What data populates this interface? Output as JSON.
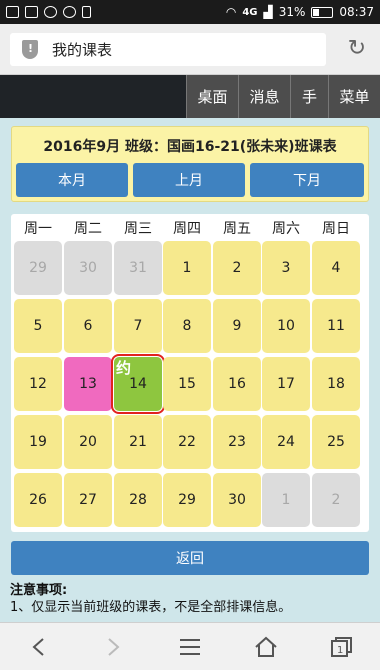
{
  "status_bar": {
    "network": "4G",
    "battery_percent": "31%",
    "time": "08:37"
  },
  "address_bar": {
    "page_title": "我的课表"
  },
  "top_nav": {
    "items": [
      "桌面",
      "消息",
      "手",
      "菜单"
    ]
  },
  "schedule": {
    "title": "2016年9月 班级：国画16-21(张未来)班课表",
    "buttons": {
      "this_month": "本月",
      "prev_month": "上月",
      "next_month": "下月"
    },
    "weekdays": [
      "周一",
      "周二",
      "周三",
      "周四",
      "周五",
      "周六",
      "周日"
    ],
    "days": [
      {
        "label": "29",
        "current_month": false
      },
      {
        "label": "30",
        "current_month": false
      },
      {
        "label": "31",
        "current_month": false
      },
      {
        "label": "1",
        "current_month": true
      },
      {
        "label": "2",
        "current_month": true
      },
      {
        "label": "3",
        "current_month": true
      },
      {
        "label": "4",
        "current_month": true
      },
      {
        "label": "5",
        "current_month": true
      },
      {
        "label": "6",
        "current_month": true
      },
      {
        "label": "7",
        "current_month": true
      },
      {
        "label": "8",
        "current_month": true
      },
      {
        "label": "9",
        "current_month": true
      },
      {
        "label": "10",
        "current_month": true
      },
      {
        "label": "11",
        "current_month": true
      },
      {
        "label": "12",
        "current_month": true
      },
      {
        "label": "13",
        "current_month": true,
        "highlight": "pink"
      },
      {
        "label": "14",
        "current_month": true,
        "highlight": "green",
        "tag": "约",
        "selected": true
      },
      {
        "label": "15",
        "current_month": true
      },
      {
        "label": "16",
        "current_month": true
      },
      {
        "label": "17",
        "current_month": true
      },
      {
        "label": "18",
        "current_month": true
      },
      {
        "label": "19",
        "current_month": true
      },
      {
        "label": "20",
        "current_month": true
      },
      {
        "label": "21",
        "current_month": true
      },
      {
        "label": "22",
        "current_month": true
      },
      {
        "label": "23",
        "current_month": true
      },
      {
        "label": "24",
        "current_month": true
      },
      {
        "label": "25",
        "current_month": true
      },
      {
        "label": "26",
        "current_month": true
      },
      {
        "label": "27",
        "current_month": true
      },
      {
        "label": "28",
        "current_month": true
      },
      {
        "label": "29",
        "current_month": true
      },
      {
        "label": "30",
        "current_month": true
      },
      {
        "label": "1",
        "current_month": false
      },
      {
        "label": "2",
        "current_month": false
      }
    ],
    "back_button": "返回",
    "notes_heading": "注意事项:",
    "notes": [
      "1、仅显示当前班级的课表，不是全部排课信息。"
    ]
  },
  "colors": {
    "primary_button": "#3f82c0",
    "day_cell": "#f6e98d",
    "other_month_cell": "#dcdcdc",
    "pink_highlight": "#f06abf",
    "green_highlight": "#8ec63f",
    "selected_border": "#e2221e"
  }
}
